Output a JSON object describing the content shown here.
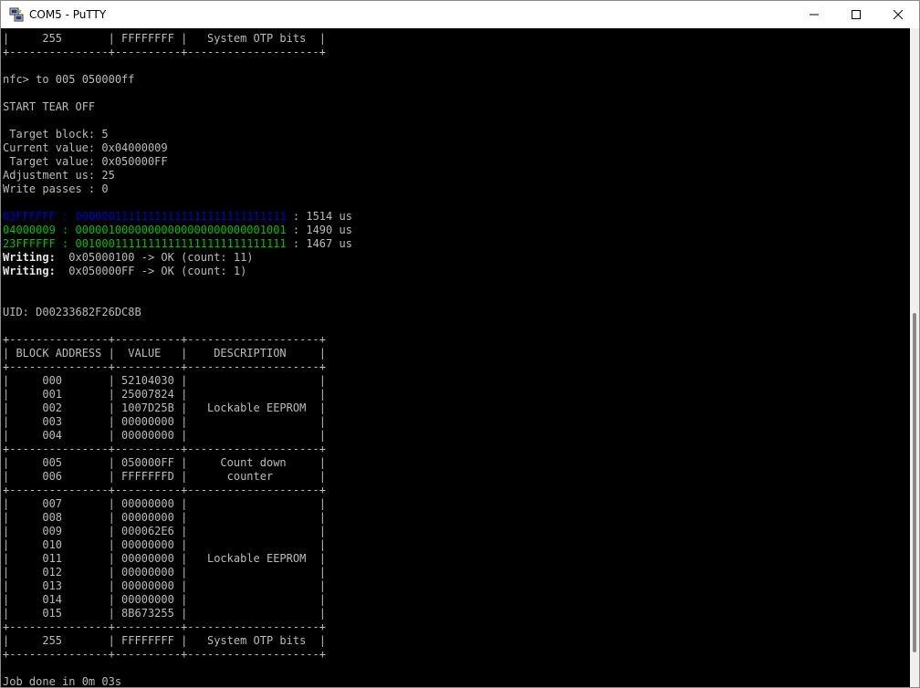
{
  "window": {
    "title": "COM5 - PuTTY"
  },
  "icons": {
    "app": "putty-icon",
    "minimize": "minimize-icon",
    "maximize": "maximize-icon",
    "close": "close-icon"
  },
  "colors": {
    "blue": "#0000c8",
    "green": "#00c000",
    "text": "#bbbbbb",
    "background": "#000000"
  },
  "terminal": {
    "lines": [
      "|     255       | FFFFFFFF |   System OTP bits  |",
      "+---------------+----------+--------------------+",
      "",
      "nfc> to 005 050000ff",
      "",
      "START TEAR OFF",
      "",
      " Target block: 5",
      "Current value: 0x04000009",
      " Target value: 0x050000FF",
      "Adjustment us: 25",
      "Write passes : 0",
      "",
      {
        "color": "blue",
        "text": "03FFFFFF : 00000011111111111111111111111111",
        "rest": " : 1514 us"
      },
      {
        "color": "green",
        "text": "04000009 : 00000100000000000000000000001001",
        "rest": " : 1490 us"
      },
      {
        "color": "green",
        "text": "23FFFFFF : 00100011111111111111111111111111",
        "rest": " : 1467 us"
      },
      {
        "bold": "Writing:",
        "rest": "  0x05000100 -> OK (count: 11)"
      },
      {
        "bold": "Writing:",
        "rest": "  0x050000FF -> OK (count: 1)"
      },
      "",
      "",
      "UID: D00233682F26DC8B",
      "",
      "+---------------+----------+--------------------+",
      "| BLOCK ADDRESS |  VALUE   |    DESCRIPTION     |",
      "+---------------+----------+--------------------+",
      "|     000       | 52104030 |                    |",
      "|     001       | 25007824 |                    |",
      "|     002       | 1007D25B |   Lockable EEPROM  |",
      "|     003       | 00000000 |                    |",
      "|     004       | 00000000 |                    |",
      "+---------------+----------+--------------------+",
      "|     005       | 050000FF |     Count down     |",
      "|     006       | FFFFFFFD |      counter       |",
      "+---------------+----------+--------------------+",
      "|     007       | 00000000 |                    |",
      "|     008       | 00000000 |                    |",
      "|     009       | 000062E6 |                    |",
      "|     010       | 00000000 |                    |",
      "|     011       | 00000000 |   Lockable EEPROM  |",
      "|     012       | 00000000 |                    |",
      "|     013       | 00000000 |                    |",
      "|     014       | 00000000 |                    |",
      "|     015       | 8B673255 |                    |",
      "+---------------+----------+--------------------+",
      "|     255       | FFFFFFFF |   System OTP bits  |",
      "+---------------+----------+--------------------+",
      "",
      "Job done in 0m 03s"
    ]
  }
}
